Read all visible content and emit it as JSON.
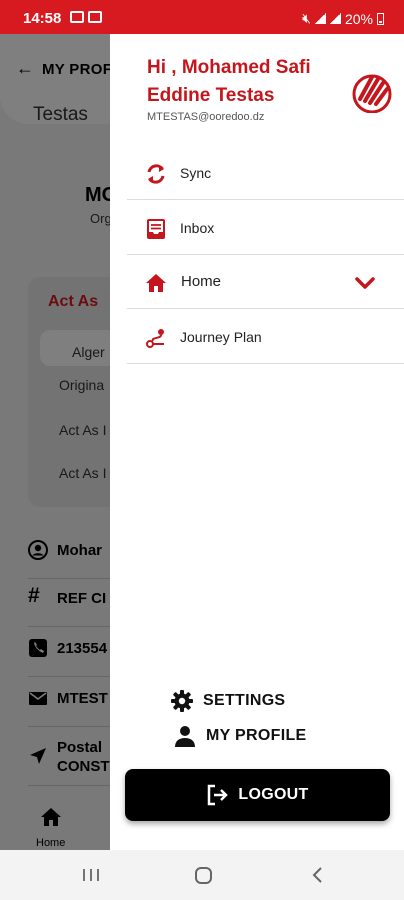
{
  "status_bar": {
    "time": "14:58",
    "battery": "20%"
  },
  "background": {
    "back_title": "MY PROF",
    "tab_label": "Testas",
    "user_short": "MO",
    "org_short": "Org",
    "act_as_title": "Act As",
    "select_value": "Alger",
    "original_label": "Origina",
    "act_as_1": "Act As I",
    "act_as_2": "Act As I",
    "info_rows": [
      {
        "icon": "person-icon",
        "text": "Mohar"
      },
      {
        "icon": "hash-icon",
        "text": "REF CI"
      },
      {
        "icon": "phone-icon",
        "text": "213554"
      },
      {
        "icon": "mail-icon",
        "text": "MTEST"
      },
      {
        "icon": "location-icon",
        "text": "Postal CONST"
      }
    ],
    "bottom_nav_home": "Home"
  },
  "drawer": {
    "greeting": "Hi , Mohamed Safi Eddine Testas",
    "email": "MTESTAS@ooredoo.dz",
    "menu": [
      {
        "label": "Sync",
        "icon": "sync-icon"
      },
      {
        "label": "Inbox",
        "icon": "inbox-icon"
      },
      {
        "label": "Home",
        "icon": "home-icon",
        "expandable": true
      },
      {
        "label": "Journey Plan",
        "icon": "route-icon"
      }
    ],
    "settings_label": "SETTINGS",
    "profile_label": "MY PROFILE",
    "logout_label": "LOGOUT"
  },
  "colors": {
    "brand_red": "#d71920",
    "accent_red": "#c4161c",
    "logout_bg": "#000000"
  }
}
